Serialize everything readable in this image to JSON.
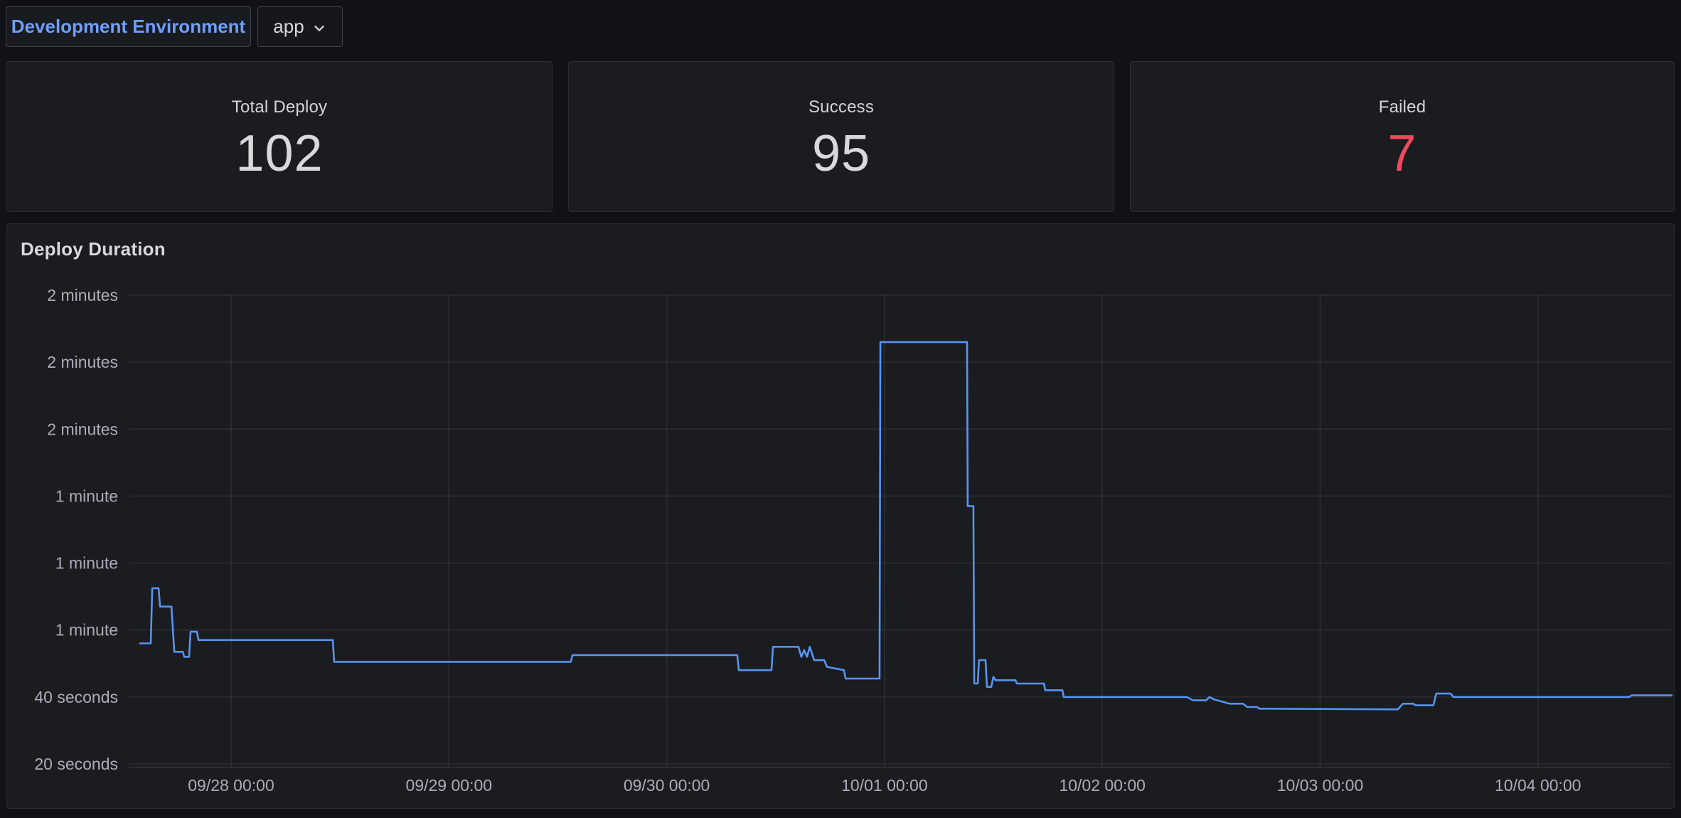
{
  "header": {
    "environment_button": "Development Environment",
    "app_dropdown_value": "app"
  },
  "stats": [
    {
      "label": "Total Deploy",
      "value": "102",
      "value_color": "#d8d9da"
    },
    {
      "label": "Success",
      "value": "95",
      "value_color": "#d8d9da"
    },
    {
      "label": "Failed",
      "value": "7",
      "value_color": "#f2495c"
    }
  ],
  "chart_data": {
    "type": "line",
    "title": "Deploy Duration",
    "legend": "none",
    "grid": true,
    "x_axis": {
      "unit": "days since 09/28 00:00",
      "tick_day_offsets": [
        0,
        1,
        2,
        3,
        4,
        5,
        6
      ],
      "tick_labels": [
        "09/28 00:00",
        "09/29 00:00",
        "09/30 00:00",
        "10/01 00:00",
        "10/02 00:00",
        "10/03 00:00",
        "10/04 00:00"
      ],
      "range": [
        -0.47,
        6.62
      ]
    },
    "y_axis": {
      "unit": "seconds",
      "tick_values": [
        160,
        140,
        120,
        100,
        80,
        60,
        40,
        20
      ],
      "tick_labels": [
        "2 minutes",
        "2 minutes",
        "2 minutes",
        "1 minute",
        "1 minute",
        "1 minute",
        "40 seconds",
        "20 seconds"
      ],
      "range": [
        19,
        163
      ]
    },
    "series": [
      {
        "name": "deploy duration",
        "color": "#5794f2",
        "points": [
          [
            -0.418,
            56
          ],
          [
            -0.369,
            56
          ],
          [
            -0.362,
            72.5
          ],
          [
            -0.333,
            72.5
          ],
          [
            -0.326,
            67
          ],
          [
            -0.274,
            67
          ],
          [
            -0.261,
            53.5
          ],
          [
            -0.222,
            53.5
          ],
          [
            -0.215,
            52
          ],
          [
            -0.193,
            52
          ],
          [
            -0.186,
            59.5
          ],
          [
            -0.157,
            59.5
          ],
          [
            -0.15,
            57
          ],
          [
            0.467,
            57
          ],
          [
            0.473,
            50.5
          ],
          [
            1.56,
            50.5
          ],
          [
            1.567,
            52.5
          ],
          [
            2.324,
            52.5
          ],
          [
            2.331,
            48
          ],
          [
            2.481,
            48
          ],
          [
            2.488,
            55
          ],
          [
            2.605,
            55
          ],
          [
            2.618,
            52
          ],
          [
            2.631,
            54
          ],
          [
            2.644,
            52
          ],
          [
            2.657,
            55
          ],
          [
            2.677,
            51
          ],
          [
            2.723,
            51
          ],
          [
            2.736,
            49
          ],
          [
            2.814,
            48
          ],
          [
            2.821,
            45.5
          ],
          [
            2.977,
            45.5
          ],
          [
            2.981,
            146
          ],
          [
            3.379,
            146
          ],
          [
            3.382,
            97
          ],
          [
            3.408,
            97
          ],
          [
            3.412,
            44
          ],
          [
            3.428,
            44
          ],
          [
            3.434,
            51
          ],
          [
            3.464,
            51
          ],
          [
            3.47,
            43
          ],
          [
            3.49,
            43
          ],
          [
            3.5,
            46
          ],
          [
            3.51,
            45
          ],
          [
            3.601,
            45
          ],
          [
            3.608,
            44
          ],
          [
            3.732,
            44
          ],
          [
            3.738,
            42
          ],
          [
            3.817,
            42
          ],
          [
            3.823,
            40
          ],
          [
            4.388,
            40
          ],
          [
            4.417,
            39
          ],
          [
            4.476,
            39
          ],
          [
            4.492,
            40
          ],
          [
            4.512,
            39.3
          ],
          [
            4.584,
            38
          ],
          [
            4.646,
            38
          ],
          [
            4.665,
            37
          ],
          [
            4.711,
            37
          ],
          [
            4.721,
            36.5
          ],
          [
            5.357,
            36.3
          ],
          [
            5.38,
            38
          ],
          [
            5.426,
            38
          ],
          [
            5.439,
            37.5
          ],
          [
            5.52,
            37.5
          ],
          [
            5.533,
            41
          ],
          [
            5.599,
            41
          ],
          [
            5.612,
            40
          ],
          [
            6.418,
            40
          ],
          [
            6.431,
            40.5
          ],
          [
            6.614,
            40.5
          ]
        ]
      }
    ]
  },
  "colors": {
    "page_bg": "#111217",
    "panel_bg": "#1a1c20",
    "panel_border": "#2c2e33",
    "link_blue": "#6e9fff",
    "text": "#d8d9da",
    "axis_text": "rgba(204,204,220,0.82)",
    "grid_line": "rgba(204,204,220,0.10)",
    "axis_line": "rgba(204,204,220,0.14)",
    "failed_red": "#f2495c",
    "series_blue": "#5794f2"
  },
  "icons": {
    "app_dropdown_chevron": "chevron-down"
  }
}
